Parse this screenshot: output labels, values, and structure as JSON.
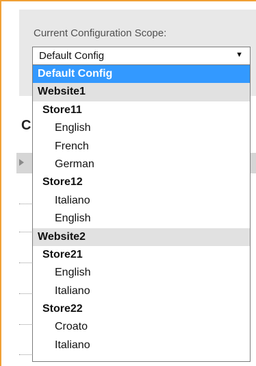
{
  "scope_label": "Current Configuration Scope:",
  "select": {
    "value": "Default Config",
    "arrow": "▼"
  },
  "underlying": {
    "heading_fragment": "C"
  },
  "colors": {
    "frame": "#f0a035",
    "selected": "#3399ff",
    "website_row": "#e1e1e1"
  },
  "options": [
    {
      "label": "Default Config",
      "kind": "selected"
    },
    {
      "label": "Website1",
      "kind": "website"
    },
    {
      "label": "Store11",
      "kind": "store"
    },
    {
      "label": "English",
      "kind": "view"
    },
    {
      "label": "French",
      "kind": "view"
    },
    {
      "label": "German",
      "kind": "view"
    },
    {
      "label": "Store12",
      "kind": "store"
    },
    {
      "label": "Italiano",
      "kind": "view"
    },
    {
      "label": "English",
      "kind": "view"
    },
    {
      "label": "Website2",
      "kind": "website"
    },
    {
      "label": "Store21",
      "kind": "store"
    },
    {
      "label": "English",
      "kind": "view"
    },
    {
      "label": "Italiano",
      "kind": "view"
    },
    {
      "label": "Store22",
      "kind": "store"
    },
    {
      "label": "Croato",
      "kind": "view"
    },
    {
      "label": "Italiano",
      "kind": "view"
    }
  ]
}
